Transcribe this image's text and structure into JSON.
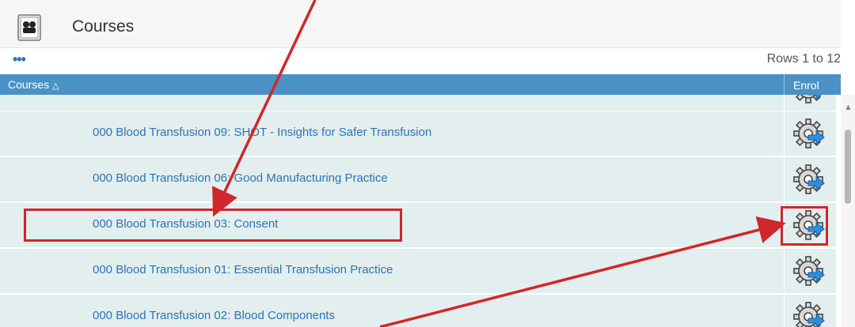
{
  "header": {
    "title": "Courses",
    "icon": "courses-icon"
  },
  "toolbar": {
    "more_icon": "•••",
    "rows_info": "Rows 1 to 12"
  },
  "table": {
    "col_courses": "Courses",
    "sort_indicator": "△",
    "col_enrol": "Enrol",
    "rows": [
      {
        "title": "000 Blood Transfusion 09: SHOT - Insights for Safer Transfusion"
      },
      {
        "title": "000 Blood Transfusion 06: Good Manufacturing Practice"
      },
      {
        "title": "000 Blood Transfusion 03: Consent"
      },
      {
        "title": "000 Blood Transfusion 01: Essential Transfusion Practice"
      },
      {
        "title": "000 Blood Transfusion 02: Blood Components"
      }
    ]
  },
  "scrollbar": {
    "up_arrow": "▲"
  },
  "colors": {
    "accent": "#4b91c6",
    "link": "#2a74b8",
    "row_bg": "#e3eeee",
    "annotation": "#d1262a"
  }
}
